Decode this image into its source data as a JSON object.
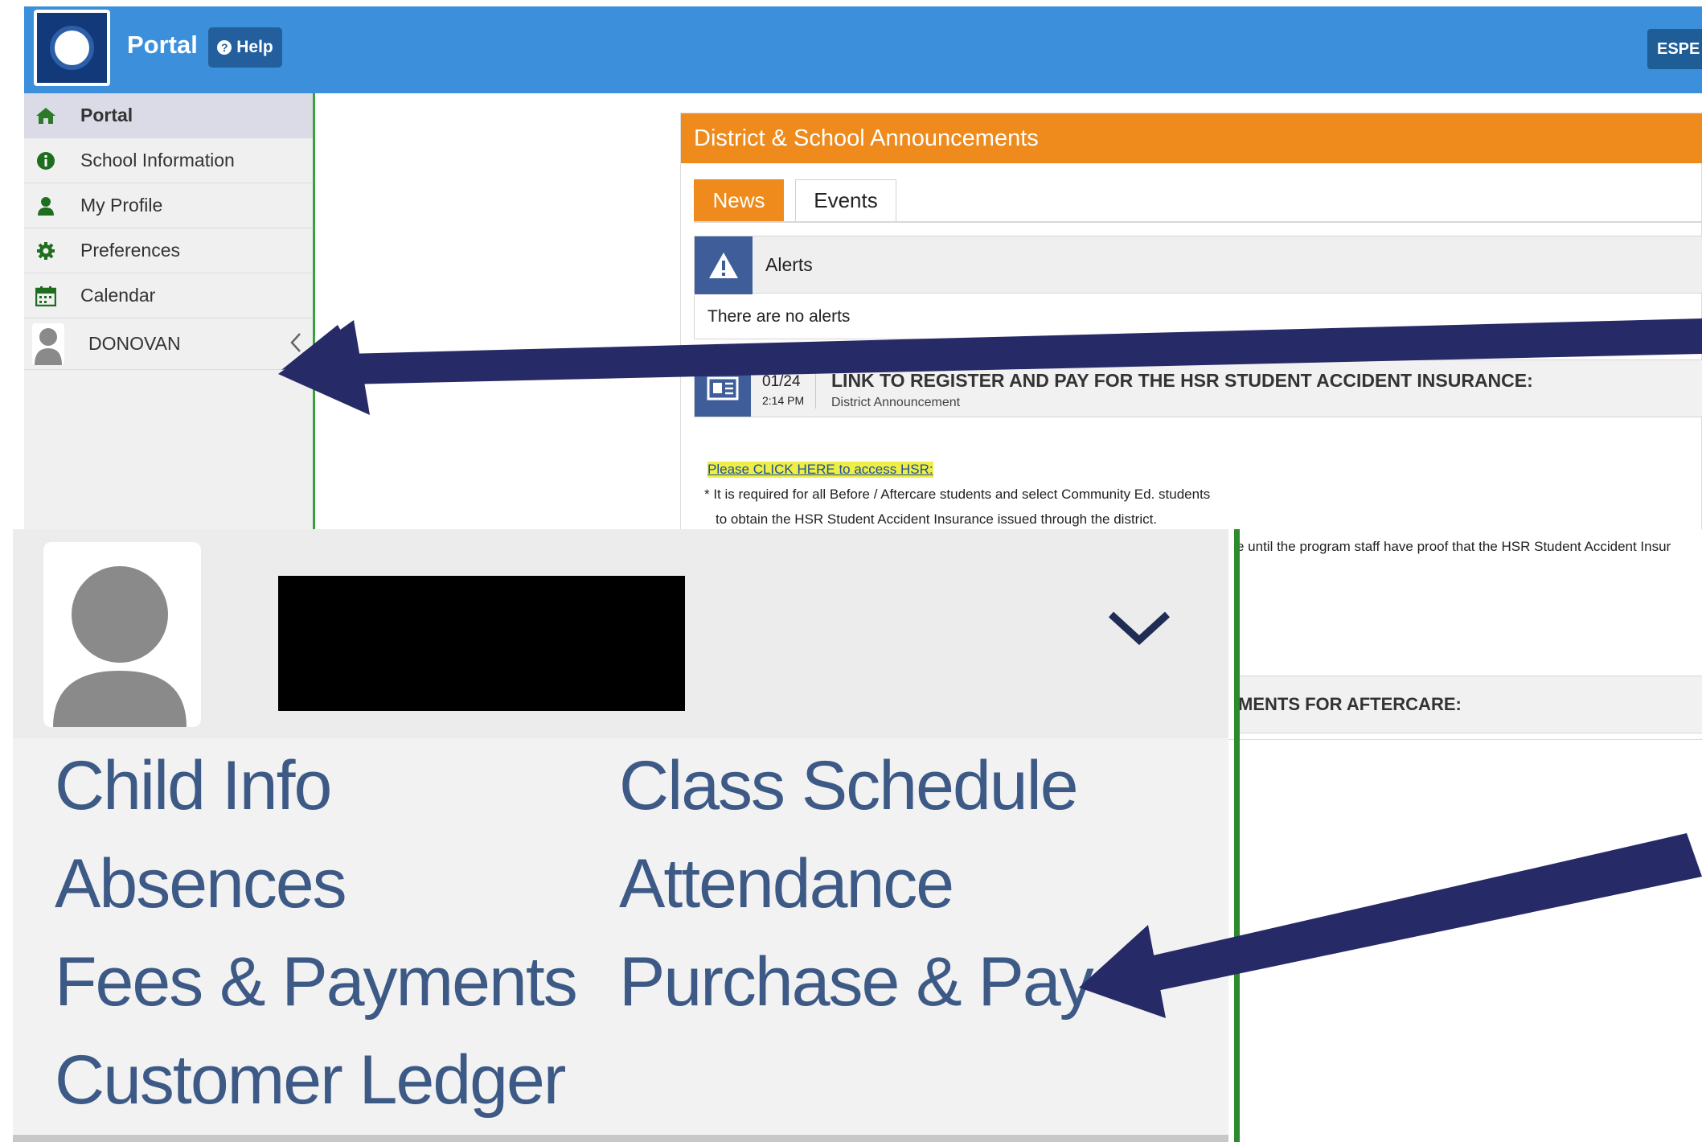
{
  "header": {
    "app_title": "Portal",
    "help_label": "Help",
    "language_button": "ESPE"
  },
  "sidebar": {
    "items": [
      {
        "label": "Portal",
        "icon": "home-icon",
        "active": true
      },
      {
        "label": "School Information",
        "icon": "info-icon"
      },
      {
        "label": "My Profile",
        "icon": "user-icon"
      },
      {
        "label": "Preferences",
        "icon": "gear-icon"
      },
      {
        "label": "Calendar",
        "icon": "calendar-icon"
      }
    ],
    "student_name": "DONOVAN"
  },
  "announcements": {
    "title": "District & School Announcements",
    "tabs": [
      "News",
      "Events"
    ],
    "alerts_title": "Alerts",
    "no_alerts_text": "There are no alerts",
    "news": {
      "date": "01/24",
      "time": "2:14 PM",
      "title": "LINK TO REGISTER AND PAY FOR THE HSR STUDENT ACCIDENT INSURANCE:",
      "subtitle": "District Announcement",
      "link_text": "Please CLICK HERE to access HSR:",
      "body_line1": "* It is required for all Before / Aftercare students and select Community Ed. students",
      "body_line2": "to obtain the HSR Student Accident Insurance issued through the district.",
      "body_line3_fragment": "e until the program staff have proof that the HSR Student Accident Insur",
      "next_title_fragment": "MENTS FOR AFTERCARE:"
    }
  },
  "student_menu": {
    "links": [
      "Child Info",
      "Class Schedule",
      "Absences",
      "Attendance",
      "Fees & Payments",
      "Purchase & Pay",
      "Customer Ledger"
    ]
  },
  "colors": {
    "topbar": "#3c8fdb",
    "announcement_header": "#ee8b1c",
    "arrow": "#262a66",
    "sidebar_border": "#3aa23a"
  }
}
